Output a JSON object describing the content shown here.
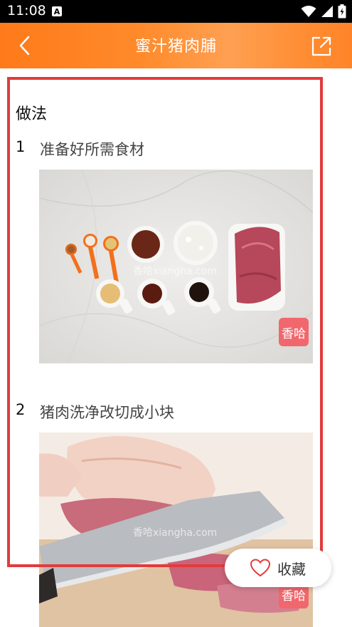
{
  "status_bar": {
    "time": "11:08",
    "notification_icon": "A"
  },
  "header": {
    "title": "蜜汁猪肉脯",
    "back_icon": "chevron-left-icon",
    "share_icon": "share-icon"
  },
  "content": {
    "section_title": "做法",
    "steps": [
      {
        "number": "1",
        "text": "准备好所需食材",
        "watermark": "香哈xiangha.com",
        "badge": "香哈"
      },
      {
        "number": "2",
        "text": "猪肉洗净改切成小块",
        "watermark": "香哈xiangha.com",
        "badge": "香哈"
      }
    ]
  },
  "favorite": {
    "label": "收藏",
    "icon": "heart-icon"
  },
  "colors": {
    "header_start": "#ff7a1a",
    "header_end": "#ff8428",
    "highlight": "#e23b3b",
    "badge": "#f0686e"
  }
}
